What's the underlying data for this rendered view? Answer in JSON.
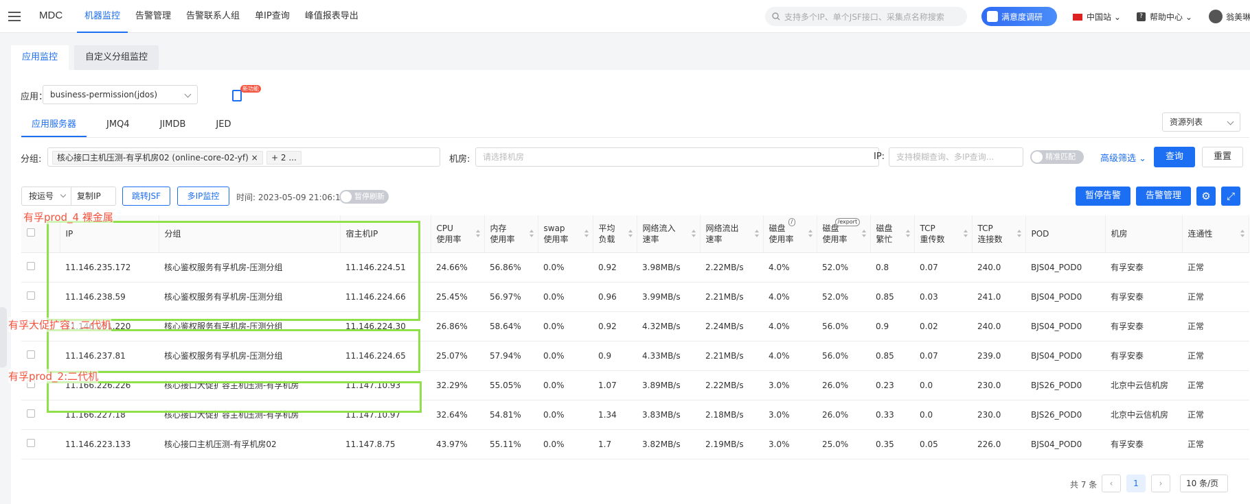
{
  "topbar": {
    "brand": "MDC",
    "nav": [
      "机器监控",
      "告警管理",
      "告警联系人组",
      "单IP查询",
      "峰值报表导出"
    ],
    "search_placeholder": "支持多个IP、单个JSF接口、采集点名称搜索",
    "survey": "满意度调研",
    "region": "中国站",
    "help": "帮助中心",
    "user": "翁美琳"
  },
  "tabs": [
    "应用监控",
    "自定义分组监控"
  ],
  "filters": {
    "app_label": "应用：",
    "app_value": "business-permission(jdos)",
    "new_badge": "新功能",
    "subtabs": [
      "应用服务器",
      "JMQ4",
      "JIMDB",
      "JED"
    ],
    "resource_list": "资源列表",
    "group_label": "分组:",
    "group_tag": "核心接口主机压测-有孚机房02 (online-core-02-yf)",
    "group_more": "+ 2 ...",
    "room_label": "机房:",
    "room_placeholder": "请选择机房",
    "ip_label": "IP:",
    "ip_placeholder": "支持模糊查询、多IP查询...",
    "exact_match": "精准匹配",
    "advanced": "高级筛选",
    "query": "查询",
    "reset": "重置"
  },
  "toolbar": {
    "sort": "按运号",
    "copy_ip": "复制IP",
    "jump_jsf": "跳转JSF",
    "multi_ip": "多IP监控",
    "time": "时间: 2023-05-09 21:06:11",
    "pause_refresh": "暂停刷新",
    "pause_alarm": "暂停告警",
    "alarm_mgmt": "告警管理"
  },
  "table": {
    "headers": [
      [
        "IP"
      ],
      [
        "分组"
      ],
      [
        "宿主机IP"
      ],
      [
        "CPU",
        "使用率"
      ],
      [
        "内存",
        "使用率"
      ],
      [
        "swap",
        "使用率"
      ],
      [
        "平均",
        "负载"
      ],
      [
        "网络流入",
        "速率"
      ],
      [
        "网络流出",
        "速率"
      ],
      [
        "磁盘",
        "使用率"
      ],
      [
        "磁盘",
        "使用率"
      ],
      [
        "磁盘",
        "繁忙"
      ],
      [
        "TCP",
        "重传数"
      ],
      [
        "TCP",
        "连接数"
      ],
      [
        "POD"
      ],
      [
        "机房"
      ],
      [
        "连通性"
      ]
    ],
    "disk_badge_1": "/",
    "disk_badge_2": "/export",
    "rows": [
      [
        "11.146.235.172",
        "核心鉴权服务有孚机房-压测分组",
        "11.146.224.51",
        "24.66%",
        "56.86%",
        "0.0%",
        "0.92",
        "3.98MB/s",
        "2.22MB/s",
        "4.0%",
        "52.0%",
        "0.8",
        "0.07",
        "240.0",
        "BJS04_POD0",
        "有孚安泰",
        "正常"
      ],
      [
        "11.146.238.59",
        "核心鉴权服务有孚机房-压测分组",
        "11.146.224.66",
        "25.45%",
        "56.97%",
        "0.0%",
        "0.96",
        "3.99MB/s",
        "2.21MB/s",
        "4.0%",
        "52.0%",
        "0.85",
        "0.03",
        "241.0",
        "BJS04_POD0",
        "有孚安泰",
        "正常"
      ],
      [
        "11.146.231.220",
        "核心鉴权服务有孚机房-压测分组",
        "11.146.224.30",
        "26.86%",
        "58.64%",
        "0.0%",
        "0.92",
        "4.32MB/s",
        "2.24MB/s",
        "4.0%",
        "56.0%",
        "0.9",
        "0.02",
        "240.0",
        "BJS04_POD0",
        "有孚安泰",
        "正常"
      ],
      [
        "11.146.237.81",
        "核心鉴权服务有孚机房-压测分组",
        "11.146.224.65",
        "25.07%",
        "57.94%",
        "0.0%",
        "0.9",
        "4.33MB/s",
        "2.21MB/s",
        "4.0%",
        "56.0%",
        "0.85",
        "0.07",
        "239.0",
        "BJS04_POD0",
        "有孚安泰",
        "正常"
      ],
      [
        "11.166.226.226",
        "核心接口大促扩容主机压测-有孚机房",
        "11.147.10.93",
        "32.29%",
        "55.05%",
        "0.0%",
        "1.07",
        "3.89MB/s",
        "2.22MB/s",
        "3.0%",
        "26.0%",
        "0.23",
        "0.0",
        "230.0",
        "BJS26_POD0",
        "北京中云信机房",
        "正常"
      ],
      [
        "11.166.227.18",
        "核心接口大促扩容主机压测-有孚机房",
        "11.147.10.97",
        "32.64%",
        "54.81%",
        "0.0%",
        "1.34",
        "3.83MB/s",
        "2.18MB/s",
        "3.0%",
        "26.0%",
        "0.33",
        "0.0",
        "230.0",
        "BJS26_POD0",
        "北京中云信机房",
        "正常"
      ],
      [
        "11.146.223.133",
        "核心接口主机压测-有孚机房02",
        "11.147.8.75",
        "43.97%",
        "55.11%",
        "0.0%",
        "1.7",
        "3.82MB/s",
        "2.19MB/s",
        "3.0%",
        "25.0%",
        "0.35",
        "0.05",
        "226.0",
        "BJS04_POD0",
        "有孚安泰",
        "正常"
      ]
    ]
  },
  "annotations": [
    "有孚prod_4 裸金属",
    "有孚大促扩容：二代机",
    "有孚prod_2:二代机"
  ],
  "pagination": {
    "total": "共 7 条",
    "current": "1",
    "page_size": "10 条/页"
  },
  "colors": {
    "primary": "#1c6ef2",
    "success": "#52c41a",
    "annotation_box": "#8fe04a",
    "annotation_text": "#f5533d"
  }
}
